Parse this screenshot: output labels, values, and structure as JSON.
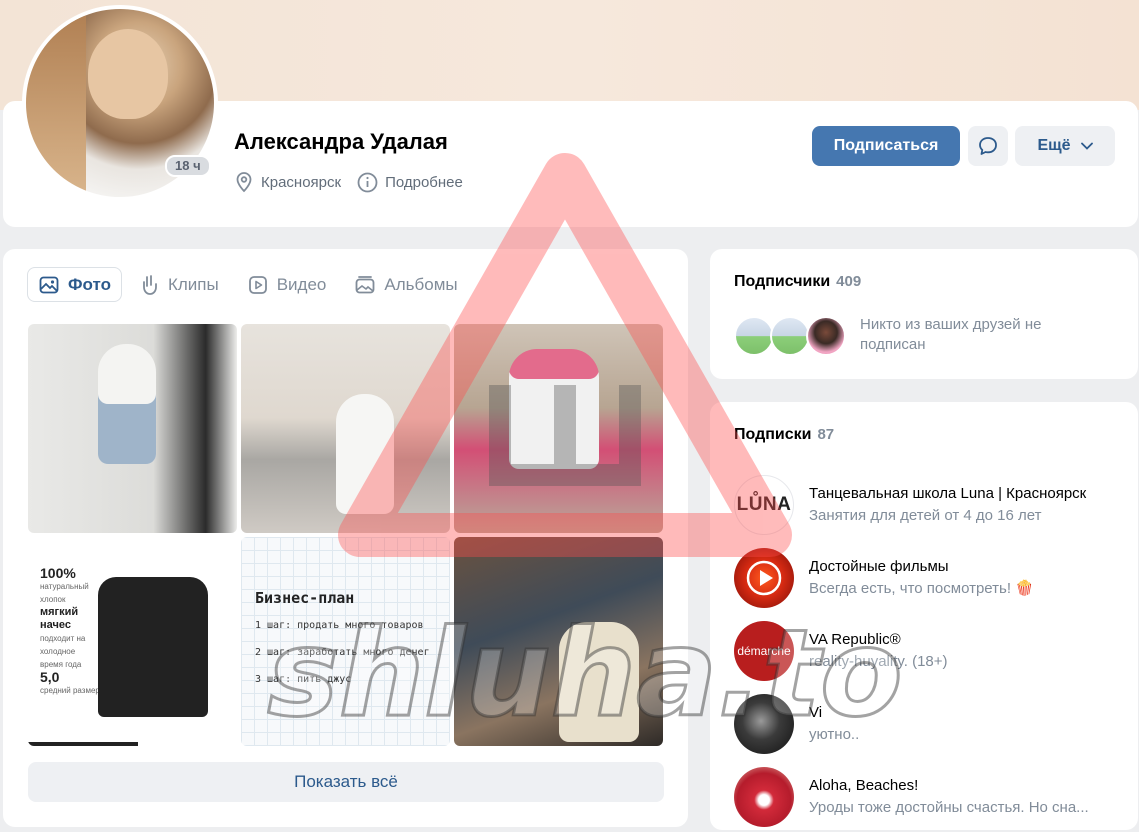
{
  "profile": {
    "name": "Александра Удалая",
    "online_badge": "18 ч",
    "city": "Красноярск",
    "details_label": "Подробнее",
    "subscribe_label": "Подписаться",
    "more_label": "Ещё"
  },
  "media": {
    "tabs": [
      {
        "label": "Фото",
        "icon": "image-icon",
        "active": true
      },
      {
        "label": "Клипы",
        "icon": "clips-icon",
        "active": false
      },
      {
        "label": "Видео",
        "icon": "video-icon",
        "active": false
      },
      {
        "label": "Альбомы",
        "icon": "albums-icon",
        "active": false
      }
    ],
    "photo4": {
      "percent": "100%",
      "line1": "натуральный хлопок",
      "soft": "мягкий начес",
      "line2": "подходит на холодное время года",
      "size": "5,0",
      "line3": "средний размер"
    },
    "photo5": {
      "title": "Бизнес-план",
      "steps": [
        "1 шаг: продать много товаров",
        "2 шаг: заработать много денег",
        "3 шаг: пить джус"
      ]
    },
    "show_all_label": "Показать всё"
  },
  "followers": {
    "title": "Подписчики",
    "count": "409",
    "note": "Никто из ваших друзей не подписан"
  },
  "subscriptions": {
    "title": "Подписки",
    "count": "87",
    "items": [
      {
        "name": "Танцевальная школа Luna | Красноярск",
        "desc": "Занятия для детей от 4 до 16 лет",
        "avatar_text": "LŮNA"
      },
      {
        "name": "Достойные фильмы",
        "desc": "Всегда есть, что посмотреть! 🍿",
        "avatar_text": ""
      },
      {
        "name": "VA Republic®",
        "desc": "reality-huyality. (18+)",
        "avatar_text": "démarche"
      },
      {
        "name": "Vi",
        "desc": "уютно..",
        "avatar_text": ""
      },
      {
        "name": "Aloha, Beaches!",
        "desc": "Уроды тоже достойны счастья. Но сна...",
        "avatar_text": ""
      }
    ]
  },
  "watermark_text": "shluha.to",
  "colors": {
    "accent": "#4577b0",
    "link": "#2c5a8c",
    "muted": "#818c99",
    "background": "#edeef0",
    "watermark": "#ff5a5a"
  }
}
